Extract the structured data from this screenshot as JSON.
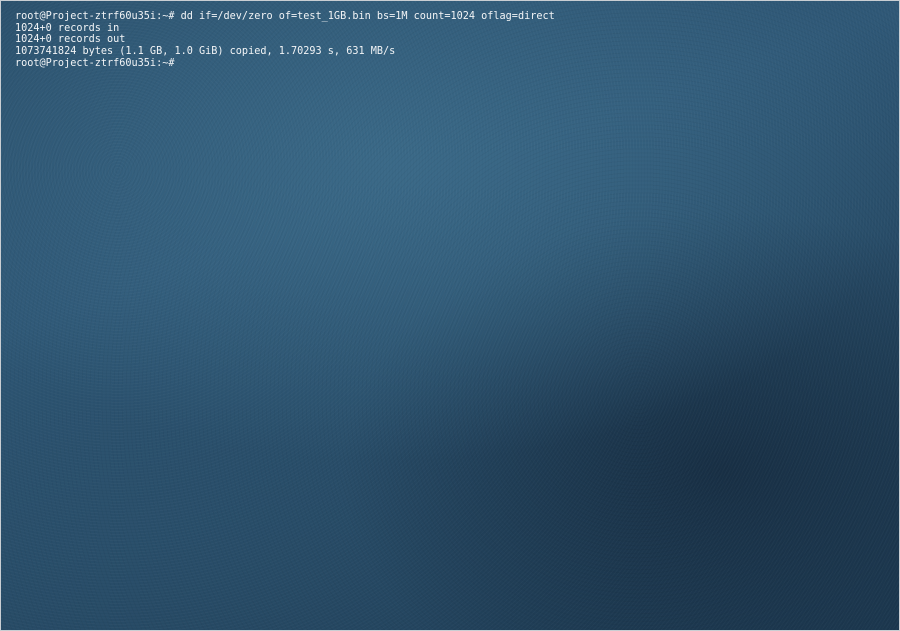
{
  "terminal": {
    "lines": [
      "root@Project-ztrf60u35i:~# dd if=/dev/zero of=test_1GB.bin bs=1M count=1024 oflag=direct",
      "1024+0 records in",
      "1024+0 records out",
      "1073741824 bytes (1.1 GB, 1.0 GiB) copied, 1.70293 s, 631 MB/s"
    ],
    "prompt": "root@Project-ztrf60u35i:~#"
  }
}
